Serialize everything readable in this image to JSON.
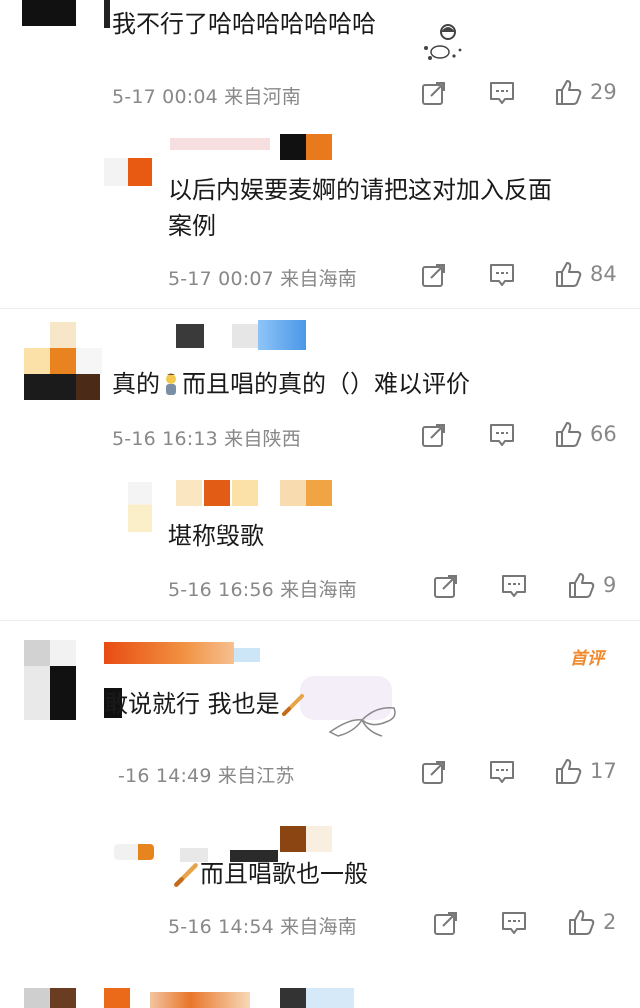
{
  "comments": [
    {
      "text": "我不行了哈哈哈哈哈哈哈",
      "meta": "5-17 00:04 来自河南",
      "likes": "29"
    },
    {
      "text_line1": "以后内娱要麦婀的请把这对加入反面",
      "text_line2": "案例",
      "meta": "5-17 00:07 来自海南",
      "likes": "84"
    },
    {
      "text_a": "真的",
      "text_b": "而且唱的真的（）难以评价",
      "meta": "5-16 16:13 来自陕西",
      "likes": "66"
    },
    {
      "text": "堪称毁歌",
      "meta": "5-16 16:56 来自海南",
      "likes": "9"
    },
    {
      "text": "敢说就行 我也是",
      "badge": "首评",
      "meta": "-16 14:49 来自江苏",
      "likes": "17"
    },
    {
      "text": "而且唱歌也一般",
      "meta": "5-16 14:54 来自海南",
      "likes": "2"
    }
  ],
  "icons": {
    "share": "share-icon",
    "comment": "comment-icon",
    "like": "thumbs-up-icon"
  },
  "colors": {
    "badge": "#f08a2c",
    "meta": "#888888"
  }
}
